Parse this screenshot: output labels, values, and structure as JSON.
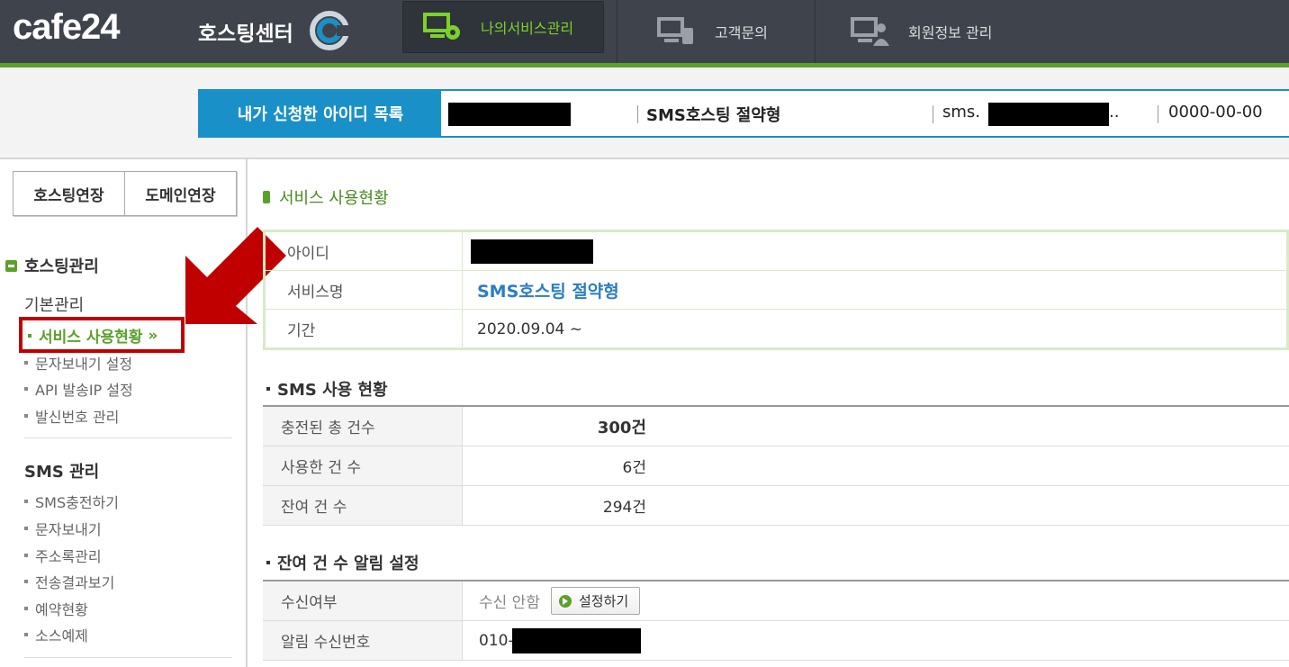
{
  "header": {
    "logo": "cafe24",
    "logo_sub": "호스팅센터",
    "nav": [
      {
        "label": "나의서비스관리",
        "active": true
      },
      {
        "label": "고객문의",
        "active": false
      },
      {
        "label": "회원정보 관리",
        "active": false
      }
    ],
    "accent_green": "#5aa12a",
    "dark_bg": "#3e434c"
  },
  "id_bar": {
    "label": "내가 신청한 아이디 목록",
    "service": "SMS호스팅 절약형",
    "domain_prefix": "sms.",
    "domain_suffix": "..",
    "date": "0000-00-00",
    "accent_blue": "#1a90c8"
  },
  "sidebar": {
    "buttons": [
      "호스팅연장",
      "도메인연장"
    ],
    "section_title": "호스팅관리",
    "groups": [
      {
        "title": "기본관리",
        "items": [
          "서비스 사용현황",
          "문자보내기 설정",
          "API 발송IP 설정",
          "발신번호 관리"
        ]
      },
      {
        "title": "SMS 관리",
        "items": [
          "SMS충전하기",
          "문자보내기",
          "주소록관리",
          "전송결과보기",
          "예약현황",
          "소스예제"
        ]
      }
    ],
    "active_suffix": "»"
  },
  "content": {
    "title": "서비스 사용현황",
    "info": {
      "id_label": "아이디",
      "service_label": "서비스명",
      "service_value": "SMS호스팅 절약형",
      "period_label": "기간",
      "period_value": "2020.09.04 ~"
    },
    "sms_usage": {
      "title": "SMS 사용 현황",
      "rows": [
        {
          "label": "충전된 총 건수",
          "value": "300건"
        },
        {
          "label": "사용한 건 수",
          "value": "6건"
        },
        {
          "label": "잔여 건 수",
          "value": "294건"
        }
      ]
    },
    "alert": {
      "title": "잔여 건 수 알림 설정",
      "receive_label": "수신여부",
      "receive_value": "수신 안함",
      "settings_button": "설정하기",
      "phone_label": "알림 수신번호",
      "phone_prefix": "010-"
    }
  }
}
